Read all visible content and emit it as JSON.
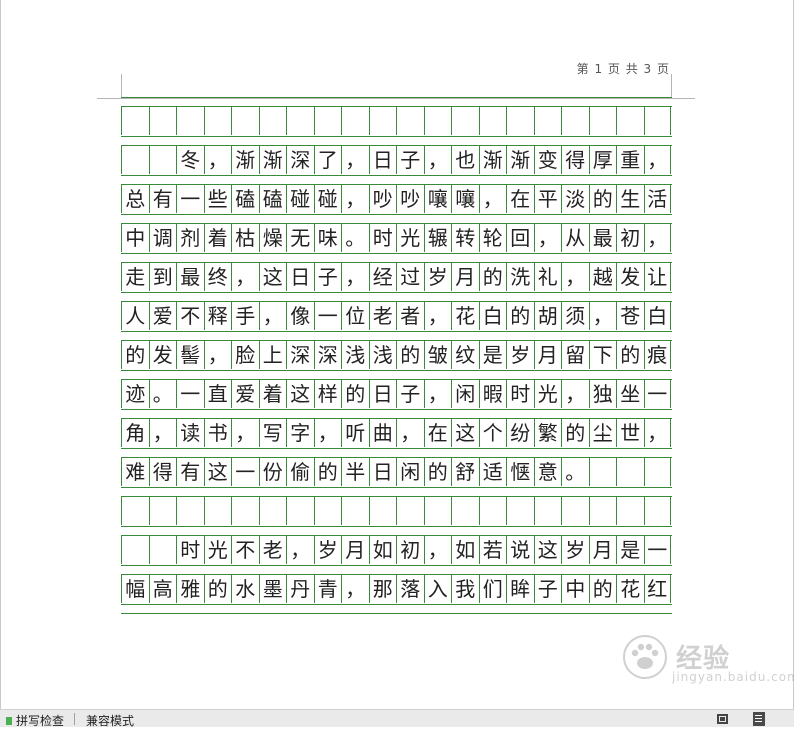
{
  "page": {
    "number_label": "第 1 页 共 3 页"
  },
  "document": {
    "rows": [
      "                    ",
      "  冬，渐渐深了，日子，也渐渐变得厚重，",
      "总有一些磕磕碰碰，吵吵嚷嚷，在平淡的生活",
      "中调剂着枯燥无味。时光辗转轮回，从最初，",
      "走到最终，这日子，经过岁月的洗礼，越发让",
      "人爱不释手，像一位老者，花白的胡须，苍白",
      "的发髻，脸上深深浅浅的皱纹是岁月留下的痕",
      "迹。一直爱着这样的日子，闲暇时光，独坐一",
      "角，读书，写字，听曲，在这个纷繁的尘世，",
      "难得有这一份偷的半日闲的舒适惬意。      ",
      "                    ",
      "  时光不老，岁月如初，如若说这岁月是一",
      "幅高雅的水墨丹青，那落入我们眸子中的花红"
    ]
  },
  "status_bar": {
    "spell_check": "拼写检查",
    "compat_mode": "兼容模式"
  },
  "icons": {
    "fit": "fit-window-icon",
    "view": "page-view-icon"
  },
  "watermark": {
    "text": "经验",
    "url": "jingyan.baidu.com"
  },
  "colors": {
    "grid_line": "#3b8a3b",
    "spell_indicator": "#4caf50"
  }
}
